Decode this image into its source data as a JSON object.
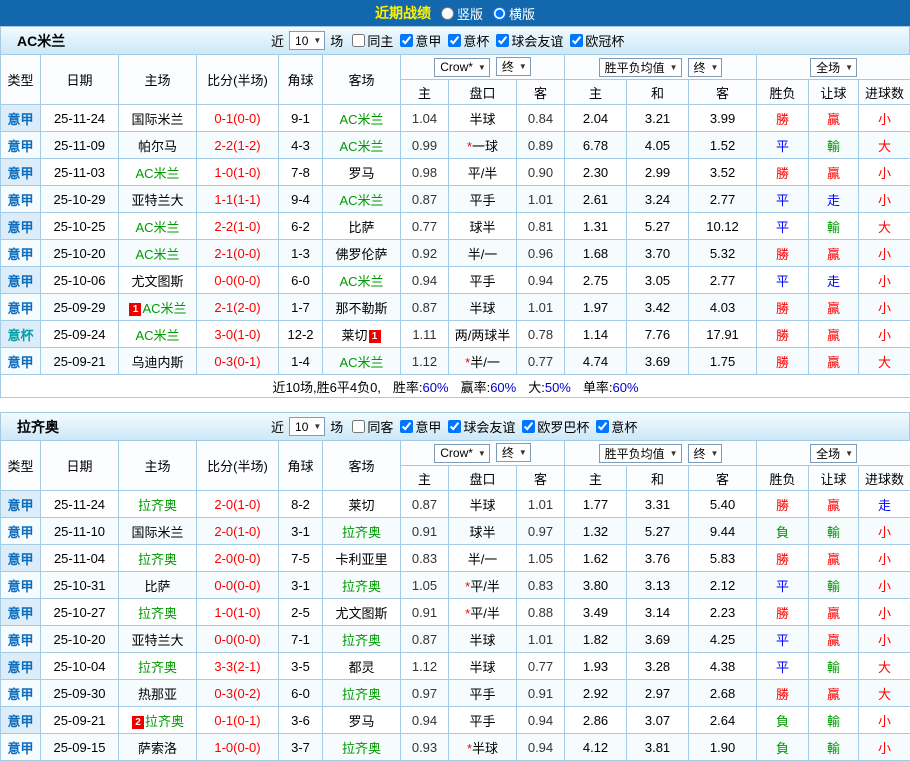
{
  "topbar": {
    "title": "近期战绩",
    "options": [
      {
        "label": "竖版",
        "selected": false
      },
      {
        "label": "横版",
        "selected": true
      }
    ]
  },
  "colors": {
    "topbar_bg": "#1368ad",
    "title_text": "#ffef00",
    "grid_border": "#a3cbe5",
    "league_type": "#0a6cbe",
    "cup_type": "#00a0a6",
    "tracked_team": "#009900",
    "score_red": "#ff0000",
    "win_red": "#ff0000",
    "draw_blue": "#0000ff",
    "loss_green": "#009900"
  },
  "sections": [
    {
      "team": "AC米兰",
      "filter": {
        "near": "近",
        "count": "10",
        "games": "场",
        "checkboxes": [
          {
            "label": "同主",
            "checked": false
          },
          {
            "label": "意甲",
            "checked": true
          },
          {
            "label": "意杯",
            "checked": true
          },
          {
            "label": "球会友谊",
            "checked": true
          },
          {
            "label": "欧冠杯",
            "checked": true
          }
        ]
      },
      "header": {
        "cols": [
          "类型",
          "日期",
          "主场",
          "比分(半场)",
          "角球",
          "客场"
        ],
        "odds_select": "Crow*",
        "odds_state": "终",
        "europe_select": "胜平负均值",
        "europe_state": "终",
        "fulltime_select": "全场",
        "sub": [
          "主",
          "盘口",
          "客",
          "主",
          "和",
          "客",
          "胜负",
          "让球",
          "进球数"
        ]
      },
      "rows": [
        {
          "type": "意甲",
          "cup": false,
          "date": "25-11-24",
          "home": "国际米兰",
          "home_hl": false,
          "home_badge": "",
          "score": "0-1(0-0)",
          "corner": "9-1",
          "away": "AC米兰",
          "away_hl": true,
          "away_badge": "",
          "odds_home": "1.04",
          "handicap": "半球",
          "handicap_star": false,
          "odds_away": "0.84",
          "eu_home": "2.04",
          "eu_draw": "3.21",
          "eu_away": "3.99",
          "results": [
            [
              "勝",
              "red"
            ],
            [
              "贏",
              "red"
            ],
            [
              "小",
              "red"
            ]
          ]
        },
        {
          "type": "意甲",
          "cup": false,
          "date": "25-11-09",
          "home": "帕尔马",
          "home_hl": false,
          "home_badge": "",
          "score": "2-2(1-2)",
          "corner": "4-3",
          "away": "AC米兰",
          "away_hl": true,
          "away_badge": "",
          "odds_home": "0.99",
          "handicap": "一球",
          "handicap_star": true,
          "odds_away": "0.89",
          "eu_home": "6.78",
          "eu_draw": "4.05",
          "eu_away": "1.52",
          "results": [
            [
              "平",
              "blue"
            ],
            [
              "輸",
              "green"
            ],
            [
              "大",
              "red"
            ]
          ]
        },
        {
          "type": "意甲",
          "cup": false,
          "date": "25-11-03",
          "home": "AC米兰",
          "home_hl": true,
          "home_badge": "",
          "score": "1-0(1-0)",
          "corner": "7-8",
          "away": "罗马",
          "away_hl": false,
          "away_badge": "",
          "odds_home": "0.98",
          "handicap": "平/半",
          "handicap_star": false,
          "odds_away": "0.90",
          "eu_home": "2.30",
          "eu_draw": "2.99",
          "eu_away": "3.52",
          "results": [
            [
              "勝",
              "red"
            ],
            [
              "贏",
              "red"
            ],
            [
              "小",
              "red"
            ]
          ]
        },
        {
          "type": "意甲",
          "cup": false,
          "date": "25-10-29",
          "home": "亚特兰大",
          "home_hl": false,
          "home_badge": "",
          "score": "1-1(1-1)",
          "corner": "9-4",
          "away": "AC米兰",
          "away_hl": true,
          "away_badge": "",
          "odds_home": "0.87",
          "handicap": "平手",
          "handicap_star": false,
          "odds_away": "1.01",
          "eu_home": "2.61",
          "eu_draw": "3.24",
          "eu_away": "2.77",
          "results": [
            [
              "平",
              "blue"
            ],
            [
              "走",
              "blue"
            ],
            [
              "小",
              "red"
            ]
          ]
        },
        {
          "type": "意甲",
          "cup": false,
          "date": "25-10-25",
          "home": "AC米兰",
          "home_hl": true,
          "home_badge": "",
          "score": "2-2(1-0)",
          "corner": "6-2",
          "away": "比萨",
          "away_hl": false,
          "away_badge": "",
          "odds_home": "0.77",
          "handicap": "球半",
          "handicap_star": false,
          "odds_away": "0.81",
          "eu_home": "1.31",
          "eu_draw": "5.27",
          "eu_away": "10.12",
          "results": [
            [
              "平",
              "blue"
            ],
            [
              "輸",
              "green"
            ],
            [
              "大",
              "red"
            ]
          ]
        },
        {
          "type": "意甲",
          "cup": false,
          "date": "25-10-20",
          "home": "AC米兰",
          "home_hl": true,
          "home_badge": "",
          "score": "2-1(0-0)",
          "corner": "1-3",
          "away": "佛罗伦萨",
          "away_hl": false,
          "away_badge": "",
          "odds_home": "0.92",
          "handicap": "半/一",
          "handicap_star": false,
          "odds_away": "0.96",
          "eu_home": "1.68",
          "eu_draw": "3.70",
          "eu_away": "5.32",
          "results": [
            [
              "勝",
              "red"
            ],
            [
              "贏",
              "red"
            ],
            [
              "小",
              "red"
            ]
          ]
        },
        {
          "type": "意甲",
          "cup": false,
          "date": "25-10-06",
          "home": "尤文图斯",
          "home_hl": false,
          "home_badge": "",
          "score": "0-0(0-0)",
          "corner": "6-0",
          "away": "AC米兰",
          "away_hl": true,
          "away_badge": "",
          "odds_home": "0.94",
          "handicap": "平手",
          "handicap_star": false,
          "odds_away": "0.94",
          "eu_home": "2.75",
          "eu_draw": "3.05",
          "eu_away": "2.77",
          "results": [
            [
              "平",
              "blue"
            ],
            [
              "走",
              "blue"
            ],
            [
              "小",
              "red"
            ]
          ]
        },
        {
          "type": "意甲",
          "cup": false,
          "date": "25-09-29",
          "home": "AC米兰",
          "home_hl": true,
          "home_badge": "1",
          "score": "2-1(2-0)",
          "corner": "1-7",
          "away": "那不勒斯",
          "away_hl": false,
          "away_badge": "",
          "odds_home": "0.87",
          "handicap": "半球",
          "handicap_star": false,
          "odds_away": "1.01",
          "eu_home": "1.97",
          "eu_draw": "3.42",
          "eu_away": "4.03",
          "results": [
            [
              "勝",
              "red"
            ],
            [
              "贏",
              "red"
            ],
            [
              "小",
              "red"
            ]
          ]
        },
        {
          "type": "意杯",
          "cup": true,
          "date": "25-09-24",
          "home": "AC米兰",
          "home_hl": true,
          "home_badge": "",
          "score": "3-0(1-0)",
          "corner": "12-2",
          "away": "莱切",
          "away_hl": false,
          "away_badge": "1",
          "away_badge_after": true,
          "odds_home": "1.11",
          "handicap": "两/两球半",
          "handicap_star": false,
          "odds_away": "0.78",
          "eu_home": "1.14",
          "eu_draw": "7.76",
          "eu_away": "17.91",
          "results": [
            [
              "勝",
              "red"
            ],
            [
              "贏",
              "red"
            ],
            [
              "小",
              "red"
            ]
          ]
        },
        {
          "type": "意甲",
          "cup": false,
          "date": "25-09-21",
          "home": "乌迪内斯",
          "home_hl": false,
          "home_badge": "",
          "score": "0-3(0-1)",
          "corner": "1-4",
          "away": "AC米兰",
          "away_hl": true,
          "away_badge": "",
          "odds_home": "1.12",
          "handicap": "半/一",
          "handicap_star": true,
          "odds_away": "0.77",
          "eu_home": "4.74",
          "eu_draw": "3.69",
          "eu_away": "1.75",
          "results": [
            [
              "勝",
              "red"
            ],
            [
              "贏",
              "red"
            ],
            [
              "大",
              "red"
            ]
          ]
        }
      ],
      "footer": {
        "prefix": "近10场,胜6平4负0,",
        "stats": [
          {
            "label": "胜率:",
            "value": "60%"
          },
          {
            "label": "赢率:",
            "value": "60%"
          },
          {
            "label": "大:",
            "value": "50%"
          },
          {
            "label": "单率:",
            "value": "60%"
          }
        ]
      }
    },
    {
      "team": "拉齐奥",
      "filter": {
        "near": "近",
        "count": "10",
        "games": "场",
        "checkboxes": [
          {
            "label": "同客",
            "checked": false
          },
          {
            "label": "意甲",
            "checked": true
          },
          {
            "label": "球会友谊",
            "checked": true
          },
          {
            "label": "欧罗巴杯",
            "checked": true
          },
          {
            "label": "意杯",
            "checked": true
          }
        ]
      },
      "header": {
        "cols": [
          "类型",
          "日期",
          "主场",
          "比分(半场)",
          "角球",
          "客场"
        ],
        "odds_select": "Crow*",
        "odds_state": "终",
        "europe_select": "胜平负均值",
        "europe_state": "终",
        "fulltime_select": "全场",
        "sub": [
          "主",
          "盘口",
          "客",
          "主",
          "和",
          "客",
          "胜负",
          "让球",
          "进球数"
        ]
      },
      "rows": [
        {
          "type": "意甲",
          "cup": false,
          "date": "25-11-24",
          "home": "拉齐奥",
          "home_hl": true,
          "home_badge": "",
          "score": "2-0(1-0)",
          "corner": "8-2",
          "away": "莱切",
          "away_hl": false,
          "away_badge": "",
          "odds_home": "0.87",
          "handicap": "半球",
          "handicap_star": false,
          "odds_away": "1.01",
          "eu_home": "1.77",
          "eu_draw": "3.31",
          "eu_away": "5.40",
          "results": [
            [
              "勝",
              "red"
            ],
            [
              "贏",
              "red"
            ],
            [
              "走",
              "blue"
            ]
          ]
        },
        {
          "type": "意甲",
          "cup": false,
          "date": "25-11-10",
          "home": "国际米兰",
          "home_hl": false,
          "home_badge": "",
          "score": "2-0(1-0)",
          "corner": "3-1",
          "away": "拉齐奥",
          "away_hl": true,
          "away_badge": "",
          "odds_home": "0.91",
          "handicap": "球半",
          "handicap_star": false,
          "odds_away": "0.97",
          "eu_home": "1.32",
          "eu_draw": "5.27",
          "eu_away": "9.44",
          "results": [
            [
              "負",
              "green"
            ],
            [
              "輸",
              "green"
            ],
            [
              "小",
              "red"
            ]
          ]
        },
        {
          "type": "意甲",
          "cup": false,
          "date": "25-11-04",
          "home": "拉齐奥",
          "home_hl": true,
          "home_badge": "",
          "score": "2-0(0-0)",
          "corner": "7-5",
          "away": "卡利亚里",
          "away_hl": false,
          "away_badge": "",
          "odds_home": "0.83",
          "handicap": "半/一",
          "handicap_star": false,
          "odds_away": "1.05",
          "eu_home": "1.62",
          "eu_draw": "3.76",
          "eu_away": "5.83",
          "results": [
            [
              "勝",
              "red"
            ],
            [
              "贏",
              "red"
            ],
            [
              "小",
              "red"
            ]
          ]
        },
        {
          "type": "意甲",
          "cup": false,
          "date": "25-10-31",
          "home": "比萨",
          "home_hl": false,
          "home_badge": "",
          "score": "0-0(0-0)",
          "corner": "3-1",
          "away": "拉齐奥",
          "away_hl": true,
          "away_badge": "",
          "odds_home": "1.05",
          "handicap": "平/半",
          "handicap_star": true,
          "odds_away": "0.83",
          "eu_home": "3.80",
          "eu_draw": "3.13",
          "eu_away": "2.12",
          "results": [
            [
              "平",
              "blue"
            ],
            [
              "輸",
              "green"
            ],
            [
              "小",
              "red"
            ]
          ]
        },
        {
          "type": "意甲",
          "cup": false,
          "date": "25-10-27",
          "home": "拉齐奥",
          "home_hl": true,
          "home_badge": "",
          "score": "1-0(1-0)",
          "corner": "2-5",
          "away": "尤文图斯",
          "away_hl": false,
          "away_badge": "",
          "odds_home": "0.91",
          "handicap": "平/半",
          "handicap_star": true,
          "odds_away": "0.88",
          "eu_home": "3.49",
          "eu_draw": "3.14",
          "eu_away": "2.23",
          "results": [
            [
              "勝",
              "red"
            ],
            [
              "贏",
              "red"
            ],
            [
              "小",
              "red"
            ]
          ]
        },
        {
          "type": "意甲",
          "cup": false,
          "date": "25-10-20",
          "home": "亚特兰大",
          "home_hl": false,
          "home_badge": "",
          "score": "0-0(0-0)",
          "corner": "7-1",
          "away": "拉齐奥",
          "away_hl": true,
          "away_badge": "",
          "odds_home": "0.87",
          "handicap": "半球",
          "handicap_star": false,
          "odds_away": "1.01",
          "eu_home": "1.82",
          "eu_draw": "3.69",
          "eu_away": "4.25",
          "results": [
            [
              "平",
              "blue"
            ],
            [
              "贏",
              "red"
            ],
            [
              "小",
              "red"
            ]
          ]
        },
        {
          "type": "意甲",
          "cup": false,
          "date": "25-10-04",
          "home": "拉齐奥",
          "home_hl": true,
          "home_badge": "",
          "score": "3-3(2-1)",
          "corner": "3-5",
          "away": "都灵",
          "away_hl": false,
          "away_badge": "",
          "odds_home": "1.12",
          "handicap": "半球",
          "handicap_star": false,
          "odds_away": "0.77",
          "eu_home": "1.93",
          "eu_draw": "3.28",
          "eu_away": "4.38",
          "results": [
            [
              "平",
              "blue"
            ],
            [
              "輸",
              "green"
            ],
            [
              "大",
              "red"
            ]
          ]
        },
        {
          "type": "意甲",
          "cup": false,
          "date": "25-09-30",
          "home": "热那亚",
          "home_hl": false,
          "home_badge": "",
          "score": "0-3(0-2)",
          "corner": "6-0",
          "away": "拉齐奥",
          "away_hl": true,
          "away_badge": "",
          "odds_home": "0.97",
          "handicap": "平手",
          "handicap_star": false,
          "odds_away": "0.91",
          "eu_home": "2.92",
          "eu_draw": "2.97",
          "eu_away": "2.68",
          "results": [
            [
              "勝",
              "red"
            ],
            [
              "贏",
              "red"
            ],
            [
              "大",
              "red"
            ]
          ]
        },
        {
          "type": "意甲",
          "cup": false,
          "date": "25-09-21",
          "home": "拉齐奥",
          "home_hl": true,
          "home_badge": "2",
          "score": "0-1(0-1)",
          "corner": "3-6",
          "away": "罗马",
          "away_hl": false,
          "away_badge": "",
          "odds_home": "0.94",
          "handicap": "平手",
          "handicap_star": false,
          "odds_away": "0.94",
          "eu_home": "2.86",
          "eu_draw": "3.07",
          "eu_away": "2.64",
          "results": [
            [
              "負",
              "green"
            ],
            [
              "輸",
              "green"
            ],
            [
              "小",
              "red"
            ]
          ]
        },
        {
          "type": "意甲",
          "cup": false,
          "date": "25-09-15",
          "home": "萨索洛",
          "home_hl": false,
          "home_badge": "",
          "score": "1-0(0-0)",
          "corner": "3-7",
          "away": "拉齐奥",
          "away_hl": true,
          "away_badge": "",
          "odds_home": "0.93",
          "handicap": "半球",
          "handicap_star": true,
          "odds_away": "0.94",
          "eu_home": "4.12",
          "eu_draw": "3.81",
          "eu_away": "1.90",
          "results": [
            [
              "負",
              "green"
            ],
            [
              "輸",
              "green"
            ],
            [
              "小",
              "red"
            ]
          ]
        }
      ],
      "footer": null
    }
  ]
}
